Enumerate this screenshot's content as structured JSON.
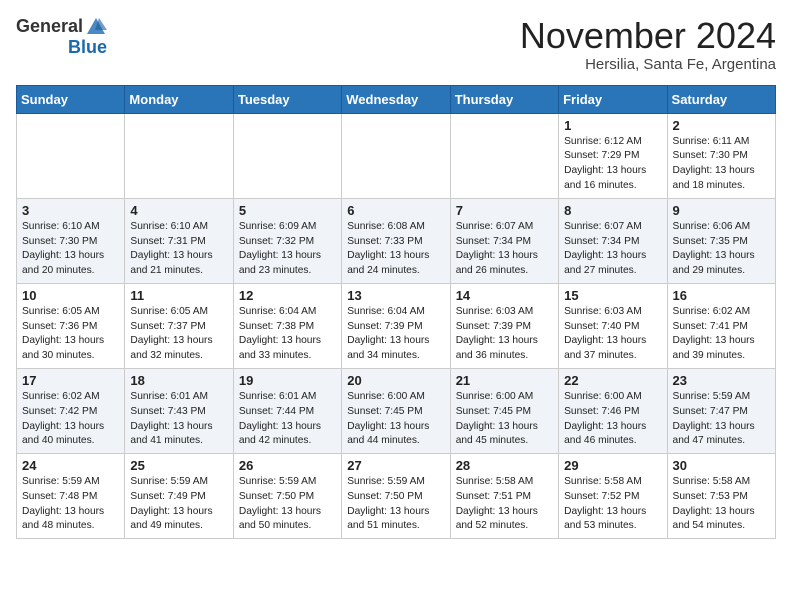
{
  "header": {
    "logo_general": "General",
    "logo_blue": "Blue",
    "month_title": "November 2024",
    "location": "Hersilia, Santa Fe, Argentina"
  },
  "weekdays": [
    "Sunday",
    "Monday",
    "Tuesday",
    "Wednesday",
    "Thursday",
    "Friday",
    "Saturday"
  ],
  "weeks": [
    [
      {
        "day": "",
        "text": ""
      },
      {
        "day": "",
        "text": ""
      },
      {
        "day": "",
        "text": ""
      },
      {
        "day": "",
        "text": ""
      },
      {
        "day": "",
        "text": ""
      },
      {
        "day": "1",
        "text": "Sunrise: 6:12 AM\nSunset: 7:29 PM\nDaylight: 13 hours\nand 16 minutes."
      },
      {
        "day": "2",
        "text": "Sunrise: 6:11 AM\nSunset: 7:30 PM\nDaylight: 13 hours\nand 18 minutes."
      }
    ],
    [
      {
        "day": "3",
        "text": "Sunrise: 6:10 AM\nSunset: 7:30 PM\nDaylight: 13 hours\nand 20 minutes."
      },
      {
        "day": "4",
        "text": "Sunrise: 6:10 AM\nSunset: 7:31 PM\nDaylight: 13 hours\nand 21 minutes."
      },
      {
        "day": "5",
        "text": "Sunrise: 6:09 AM\nSunset: 7:32 PM\nDaylight: 13 hours\nand 23 minutes."
      },
      {
        "day": "6",
        "text": "Sunrise: 6:08 AM\nSunset: 7:33 PM\nDaylight: 13 hours\nand 24 minutes."
      },
      {
        "day": "7",
        "text": "Sunrise: 6:07 AM\nSunset: 7:34 PM\nDaylight: 13 hours\nand 26 minutes."
      },
      {
        "day": "8",
        "text": "Sunrise: 6:07 AM\nSunset: 7:34 PM\nDaylight: 13 hours\nand 27 minutes."
      },
      {
        "day": "9",
        "text": "Sunrise: 6:06 AM\nSunset: 7:35 PM\nDaylight: 13 hours\nand 29 minutes."
      }
    ],
    [
      {
        "day": "10",
        "text": "Sunrise: 6:05 AM\nSunset: 7:36 PM\nDaylight: 13 hours\nand 30 minutes."
      },
      {
        "day": "11",
        "text": "Sunrise: 6:05 AM\nSunset: 7:37 PM\nDaylight: 13 hours\nand 32 minutes."
      },
      {
        "day": "12",
        "text": "Sunrise: 6:04 AM\nSunset: 7:38 PM\nDaylight: 13 hours\nand 33 minutes."
      },
      {
        "day": "13",
        "text": "Sunrise: 6:04 AM\nSunset: 7:39 PM\nDaylight: 13 hours\nand 34 minutes."
      },
      {
        "day": "14",
        "text": "Sunrise: 6:03 AM\nSunset: 7:39 PM\nDaylight: 13 hours\nand 36 minutes."
      },
      {
        "day": "15",
        "text": "Sunrise: 6:03 AM\nSunset: 7:40 PM\nDaylight: 13 hours\nand 37 minutes."
      },
      {
        "day": "16",
        "text": "Sunrise: 6:02 AM\nSunset: 7:41 PM\nDaylight: 13 hours\nand 39 minutes."
      }
    ],
    [
      {
        "day": "17",
        "text": "Sunrise: 6:02 AM\nSunset: 7:42 PM\nDaylight: 13 hours\nand 40 minutes."
      },
      {
        "day": "18",
        "text": "Sunrise: 6:01 AM\nSunset: 7:43 PM\nDaylight: 13 hours\nand 41 minutes."
      },
      {
        "day": "19",
        "text": "Sunrise: 6:01 AM\nSunset: 7:44 PM\nDaylight: 13 hours\nand 42 minutes."
      },
      {
        "day": "20",
        "text": "Sunrise: 6:00 AM\nSunset: 7:45 PM\nDaylight: 13 hours\nand 44 minutes."
      },
      {
        "day": "21",
        "text": "Sunrise: 6:00 AM\nSunset: 7:45 PM\nDaylight: 13 hours\nand 45 minutes."
      },
      {
        "day": "22",
        "text": "Sunrise: 6:00 AM\nSunset: 7:46 PM\nDaylight: 13 hours\nand 46 minutes."
      },
      {
        "day": "23",
        "text": "Sunrise: 5:59 AM\nSunset: 7:47 PM\nDaylight: 13 hours\nand 47 minutes."
      }
    ],
    [
      {
        "day": "24",
        "text": "Sunrise: 5:59 AM\nSunset: 7:48 PM\nDaylight: 13 hours\nand 48 minutes."
      },
      {
        "day": "25",
        "text": "Sunrise: 5:59 AM\nSunset: 7:49 PM\nDaylight: 13 hours\nand 49 minutes."
      },
      {
        "day": "26",
        "text": "Sunrise: 5:59 AM\nSunset: 7:50 PM\nDaylight: 13 hours\nand 50 minutes."
      },
      {
        "day": "27",
        "text": "Sunrise: 5:59 AM\nSunset: 7:50 PM\nDaylight: 13 hours\nand 51 minutes."
      },
      {
        "day": "28",
        "text": "Sunrise: 5:58 AM\nSunset: 7:51 PM\nDaylight: 13 hours\nand 52 minutes."
      },
      {
        "day": "29",
        "text": "Sunrise: 5:58 AM\nSunset: 7:52 PM\nDaylight: 13 hours\nand 53 minutes."
      },
      {
        "day": "30",
        "text": "Sunrise: 5:58 AM\nSunset: 7:53 PM\nDaylight: 13 hours\nand 54 minutes."
      }
    ]
  ]
}
